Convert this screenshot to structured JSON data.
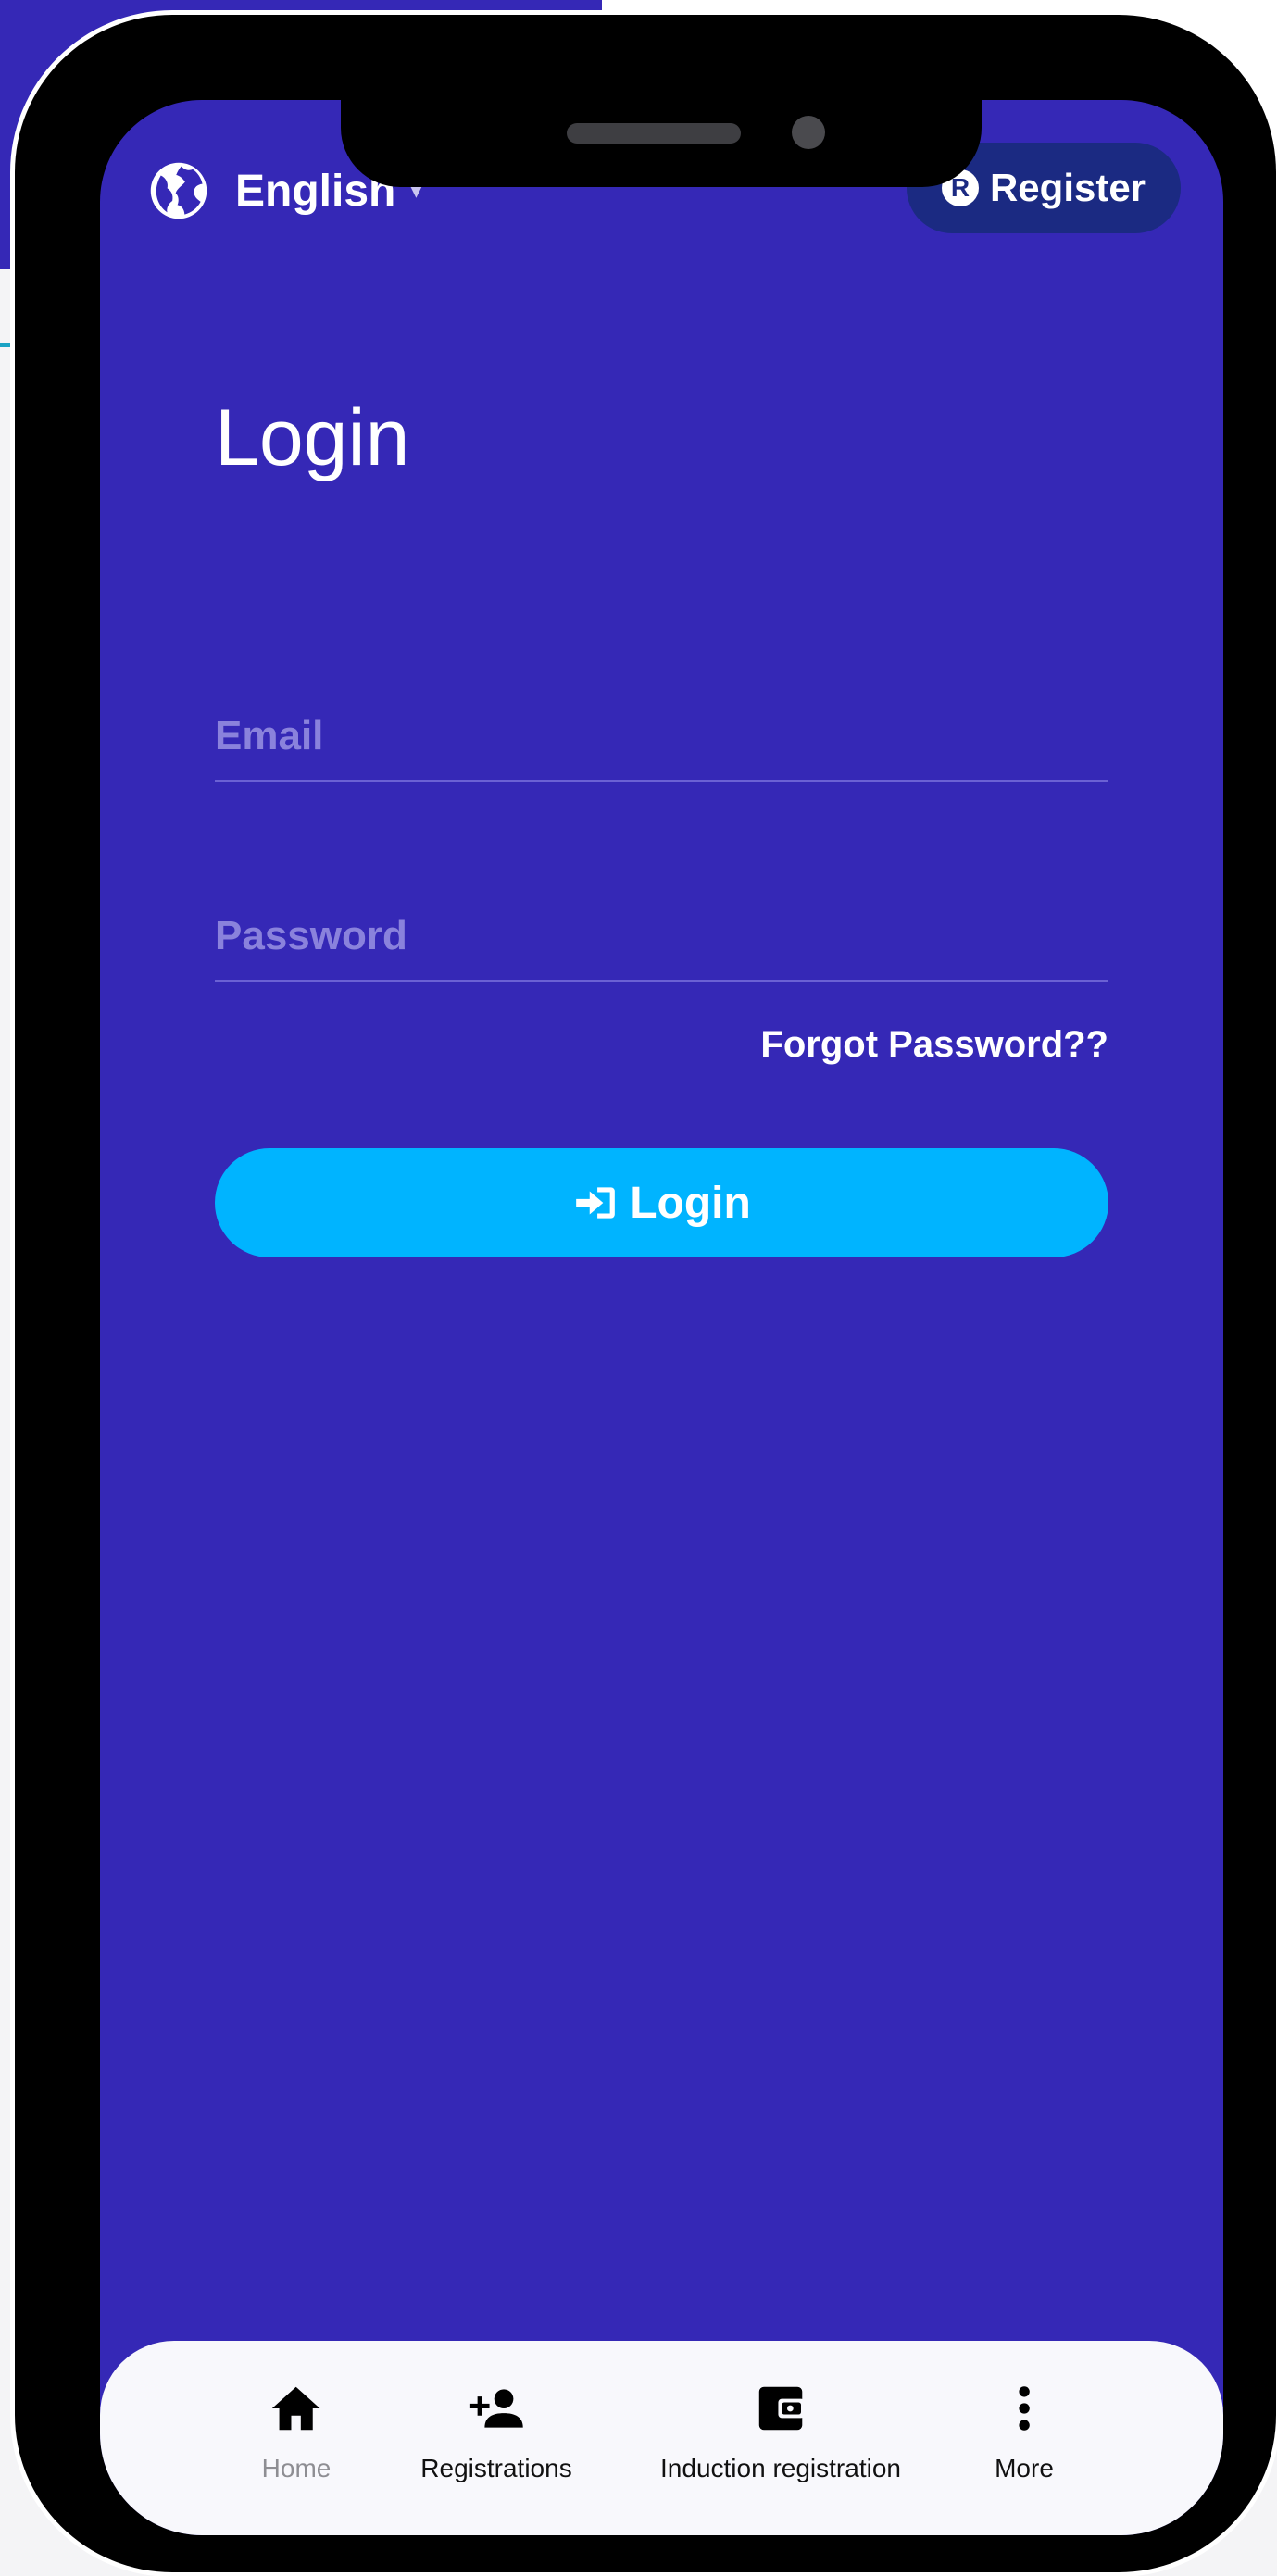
{
  "header": {
    "language_label": "English",
    "caret": "▾",
    "register_label": "Register",
    "register_icon_letter": "R"
  },
  "login_form": {
    "title": "Login",
    "email_placeholder": "Email",
    "password_placeholder": "Password",
    "forgot_label": "Forgot Password??",
    "submit_label": "Login"
  },
  "bottom_nav": {
    "items": [
      {
        "label": "Home",
        "icon": "home-icon",
        "active": true
      },
      {
        "label": "Registrations",
        "icon": "person-add-icon",
        "active": false
      },
      {
        "label": "Induction registration",
        "icon": "wallet-icon",
        "active": false
      },
      {
        "label": "More",
        "icon": "more-vert-icon",
        "active": false
      }
    ]
  },
  "colors": {
    "primary_bg": "#3528b6",
    "register_btn_bg": "#1b2a82",
    "login_btn_bg": "#00b4ff",
    "nav_bg": "#f8f8fc"
  }
}
